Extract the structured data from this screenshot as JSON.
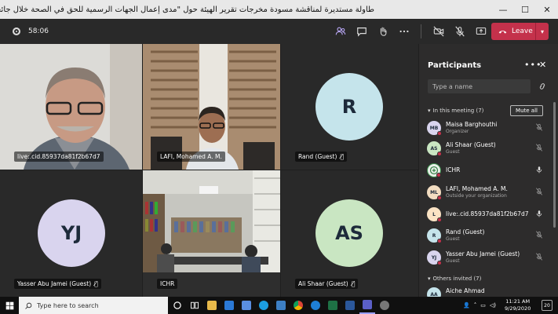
{
  "window": {
    "title": "طاولة مستديرة لمناقشة مسودة مخرجات تقرير الهيئة حول \"مدى إعمال الجهات الرسمية للحق في الصحة خلال جائحة كورونا\".",
    "minimize": "—",
    "maximize": "☐",
    "close": "✕"
  },
  "toolbar": {
    "timer": "58:06",
    "leave_label": "Leave",
    "leave_color": "#c4314b"
  },
  "tiles": [
    {
      "name": "live:.cid.85937da81f2b67d7",
      "type": "video"
    },
    {
      "name": "LAFI, Mohamed A. M.",
      "type": "video"
    },
    {
      "name": "Rand (Guest)",
      "type": "avatar",
      "initials": "R",
      "color": "#c5e4eb"
    },
    {
      "name": "Yasser Abu Jamei (Guest)",
      "type": "avatar",
      "initials": "YJ",
      "color": "#d9d4ee"
    },
    {
      "name": "ICHR",
      "type": "video"
    },
    {
      "name": "Ali Shaar (Guest)",
      "type": "avatar",
      "initials": "AS",
      "color": "#c9e6c2"
    }
  ],
  "panel": {
    "title": "Participants",
    "more": "•••",
    "close": "✕",
    "search_placeholder": "Type a name",
    "in_meeting_label": "In this meeting (7)",
    "mute_all_label": "Mute all",
    "others_label": "Others invited (7)",
    "people": [
      {
        "name": "Maisa Barghouthi",
        "role": "Organizer",
        "initials": "MB",
        "color": "#d9d4ee",
        "mic": "muted"
      },
      {
        "name": "Ali Shaar (Guest)",
        "role": "Guest",
        "initials": "AS",
        "color": "#c9e6c2",
        "mic": "muted"
      },
      {
        "name": "ICHR",
        "role": "",
        "initials": "",
        "color": "#e8f0e8",
        "mic": "on"
      },
      {
        "name": "LAFI, Mohamed A. M.",
        "role": "Outside your organization",
        "initials": "ML",
        "color": "#f3ddc1",
        "mic": "muted"
      },
      {
        "name": "live:.cid.85937da81f2b67d7",
        "role": "",
        "initials": "L",
        "color": "#fbe3c4",
        "mic": "on"
      },
      {
        "name": "Rand (Guest)",
        "role": "Guest",
        "initials": "R",
        "color": "#c5e4eb",
        "mic": "muted"
      },
      {
        "name": "Yasser Abu Jamei (Guest)",
        "role": "Guest",
        "initials": "YJ",
        "color": "#d9d4ee",
        "mic": "muted"
      }
    ],
    "invited": [
      {
        "name": "Aiche Ahmad",
        "initials": "AA",
        "color": "#c5e4eb"
      }
    ]
  },
  "taskbar": {
    "search_placeholder": "Type here to search",
    "time": "11:21 AM",
    "date": "9/29/2020",
    "notifications": "20"
  }
}
